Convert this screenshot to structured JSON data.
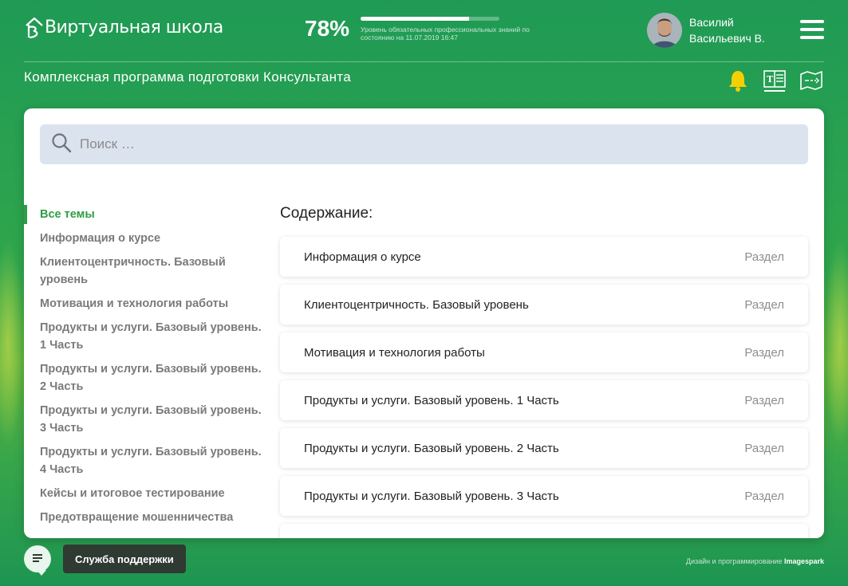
{
  "header": {
    "logo_text": "Виртуальная школа",
    "progress": {
      "percent_label": "78%",
      "fill_fraction": 0.78,
      "caption": "Уровень обязательных профессиональных знаний по состоянию на 11.07.2019 16:47"
    },
    "user": {
      "first_name": "Василий",
      "second_line": "Васильевич В."
    }
  },
  "subheader": {
    "program_title": "Комплексная программа подготовки Консультанта",
    "tools": [
      "bell-icon",
      "dictionary-icon",
      "map-icon"
    ]
  },
  "search": {
    "placeholder": "Поиск …"
  },
  "topics": [
    {
      "label": "Все темы",
      "active": true
    },
    {
      "label": "Информация о курсе"
    },
    {
      "label": "Клиентоцентричность. Базовый уровень"
    },
    {
      "label": "Мотивация и технология работы"
    },
    {
      "label": "Продукты и услуги. Базовый уровень. 1 Часть"
    },
    {
      "label": "Продукты и услуги. Базовый уровень. 2 Часть"
    },
    {
      "label": "Продукты и услуги. Базовый уровень. 3 Часть"
    },
    {
      "label": "Продукты и услуги. Базовый уровень. 4 Часть"
    },
    {
      "label": "Кейсы и итоговое тестирование"
    },
    {
      "label": "Предотвращение мошенничества"
    }
  ],
  "content": {
    "title": "Содержание:",
    "rows": [
      {
        "title": "Информация о курсе",
        "type": "Раздел"
      },
      {
        "title": "Клиентоцентричность. Базовый уровень",
        "type": "Раздел"
      },
      {
        "title": "Мотивация и технология работы",
        "type": "Раздел"
      },
      {
        "title": "Продукты и услуги. Базовый уровень. 1 Часть",
        "type": "Раздел"
      },
      {
        "title": "Продукты и услуги. Базовый уровень. 2 Часть",
        "type": "Раздел"
      },
      {
        "title": "Продукты и услуги. Базовый уровень. 3 Часть",
        "type": "Раздел"
      },
      {
        "title": "",
        "type": ""
      }
    ]
  },
  "footer": {
    "support_label": "Служба поддержки",
    "credits_prefix": "Дизайн и программирование",
    "credits_brand": "Imagespark"
  },
  "colors": {
    "accent": "#2e9d45",
    "bell": "#f5d000",
    "search_bg": "#dbe3ef"
  }
}
